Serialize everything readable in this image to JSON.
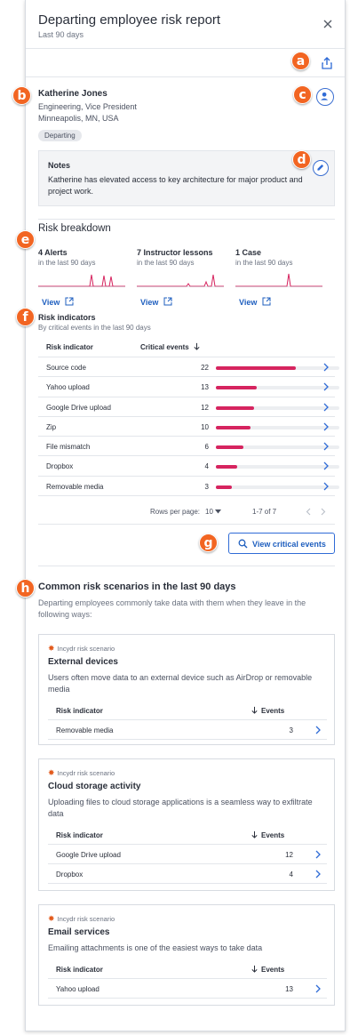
{
  "header": {
    "title": "Departing employee risk report",
    "subtitle": "Last 90 days",
    "close_icon": "close-icon",
    "share_icon": "share-icon"
  },
  "callouts": [
    "a",
    "b",
    "c",
    "d",
    "e",
    "f",
    "g",
    "h"
  ],
  "employee": {
    "name": "Katherine Jones",
    "role": "Engineering, Vice President",
    "location": "Minneapolis, MN, USA",
    "status": "Departing",
    "avatar_icon": "user-icon"
  },
  "notes": {
    "title": "Notes",
    "body": "Katherine has elevated access to key architecture for major product and project work.",
    "edit_icon": "pencil-icon"
  },
  "risk_breakdown": {
    "title": "Risk breakdown",
    "metrics": [
      {
        "title": "4 Alerts",
        "sub": "in the last 90 days",
        "link": "View"
      },
      {
        "title": "7 Instructor lessons",
        "sub": "in the last 90 days",
        "link": "View"
      },
      {
        "title": "1 Case",
        "sub": "in the last 90 days",
        "link": "View"
      }
    ]
  },
  "risk_indicators": {
    "title": "Risk indicators",
    "subtitle": "By critical events in the last 90 days",
    "col_indicator": "Risk indicator",
    "col_events": "Critical events",
    "rows": [
      {
        "name": "Source code",
        "value": "22",
        "fraction": 0.65
      },
      {
        "name": "Yahoo upload",
        "value": "13",
        "fraction": 0.33
      },
      {
        "name": "Google Drive upload",
        "value": "12",
        "fraction": 0.31
      },
      {
        "name": "Zip",
        "value": "10",
        "fraction": 0.28
      },
      {
        "name": "File mismatch",
        "value": "6",
        "fraction": 0.22
      },
      {
        "name": "Dropbox",
        "value": "4",
        "fraction": 0.17
      },
      {
        "name": "Removable media",
        "value": "3",
        "fraction": 0.13
      }
    ],
    "pager": {
      "rows_per_page_label": "Rows per page:",
      "rows_per_page": "10",
      "range": "1-7 of 7"
    },
    "view_button": "View critical events"
  },
  "scenarios": {
    "title": "Common risk scenarios in the last 90 days",
    "description": "Departing employees commonly take data with them when they leave in the following ways:",
    "tag": "Incydr risk scenario",
    "col_indicator": "Risk indicator",
    "col_events": "Events",
    "cards": [
      {
        "title": "External devices",
        "description": "Users often move data to an external device such as AirDrop or removable media",
        "rows": [
          {
            "name": "Removable media",
            "value": "3"
          }
        ]
      },
      {
        "title": "Cloud storage activity",
        "description": "Uploading files to cloud storage applications is a seamless way to exfiltrate data",
        "rows": [
          {
            "name": "Google Drive upload",
            "value": "12"
          },
          {
            "name": "Dropbox",
            "value": "4"
          }
        ]
      },
      {
        "title": "Email services",
        "description": "Emailing attachments is one of the easiest ways to take data",
        "rows": [
          {
            "name": "Yahoo upload",
            "value": "13"
          }
        ]
      }
    ]
  },
  "colors": {
    "accent": "#1f5fbf",
    "bar": "#d6245f",
    "callout": "#f26522"
  }
}
